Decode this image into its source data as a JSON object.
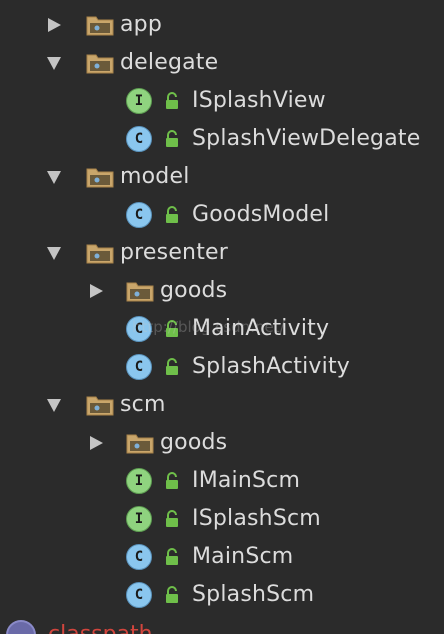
{
  "tree": {
    "items": [
      {
        "label": "app",
        "icon": "package-folder-icon",
        "expand": "collapsed"
      },
      {
        "label": "delegate",
        "icon": "package-folder-icon",
        "expand": "expanded"
      },
      {
        "label": "ISplashView",
        "icon": "interface-icon",
        "badge": "I"
      },
      {
        "label": "SplashViewDelegate",
        "icon": "class-icon",
        "badge": "C"
      },
      {
        "label": "model",
        "icon": "package-folder-icon",
        "expand": "expanded"
      },
      {
        "label": "GoodsModel",
        "icon": "class-icon",
        "badge": "C"
      },
      {
        "label": "presenter",
        "icon": "package-folder-icon",
        "expand": "expanded"
      },
      {
        "label": "goods",
        "icon": "package-folder-icon",
        "expand": "collapsed"
      },
      {
        "label": "MainActivity",
        "icon": "class-icon",
        "badge": "C"
      },
      {
        "label": "SplashActivity",
        "icon": "class-icon",
        "badge": "C"
      },
      {
        "label": "scm",
        "icon": "package-folder-icon",
        "expand": "expanded"
      },
      {
        "label": "goods",
        "icon": "package-folder-icon",
        "expand": "collapsed"
      },
      {
        "label": "IMainScm",
        "icon": "interface-icon",
        "badge": "I"
      },
      {
        "label": "ISplashScm",
        "icon": "interface-icon",
        "badge": "I"
      },
      {
        "label": "MainScm",
        "icon": "class-icon",
        "badge": "C"
      },
      {
        "label": "SplashScm",
        "icon": "class-icon",
        "badge": "C"
      }
    ],
    "classpath": {
      "label": "classpath",
      "icon": "module-icon"
    }
  },
  "watermark": "http://blog.csdn.net/",
  "colors": {
    "background": "#2b2b2b",
    "text": "#dcdcdc",
    "folder": "#c9a66b",
    "interface_badge": "#8fd37f",
    "class_badge": "#8ac6ee",
    "lock": "#6fbf4a",
    "classpath_text": "#d2453d"
  }
}
